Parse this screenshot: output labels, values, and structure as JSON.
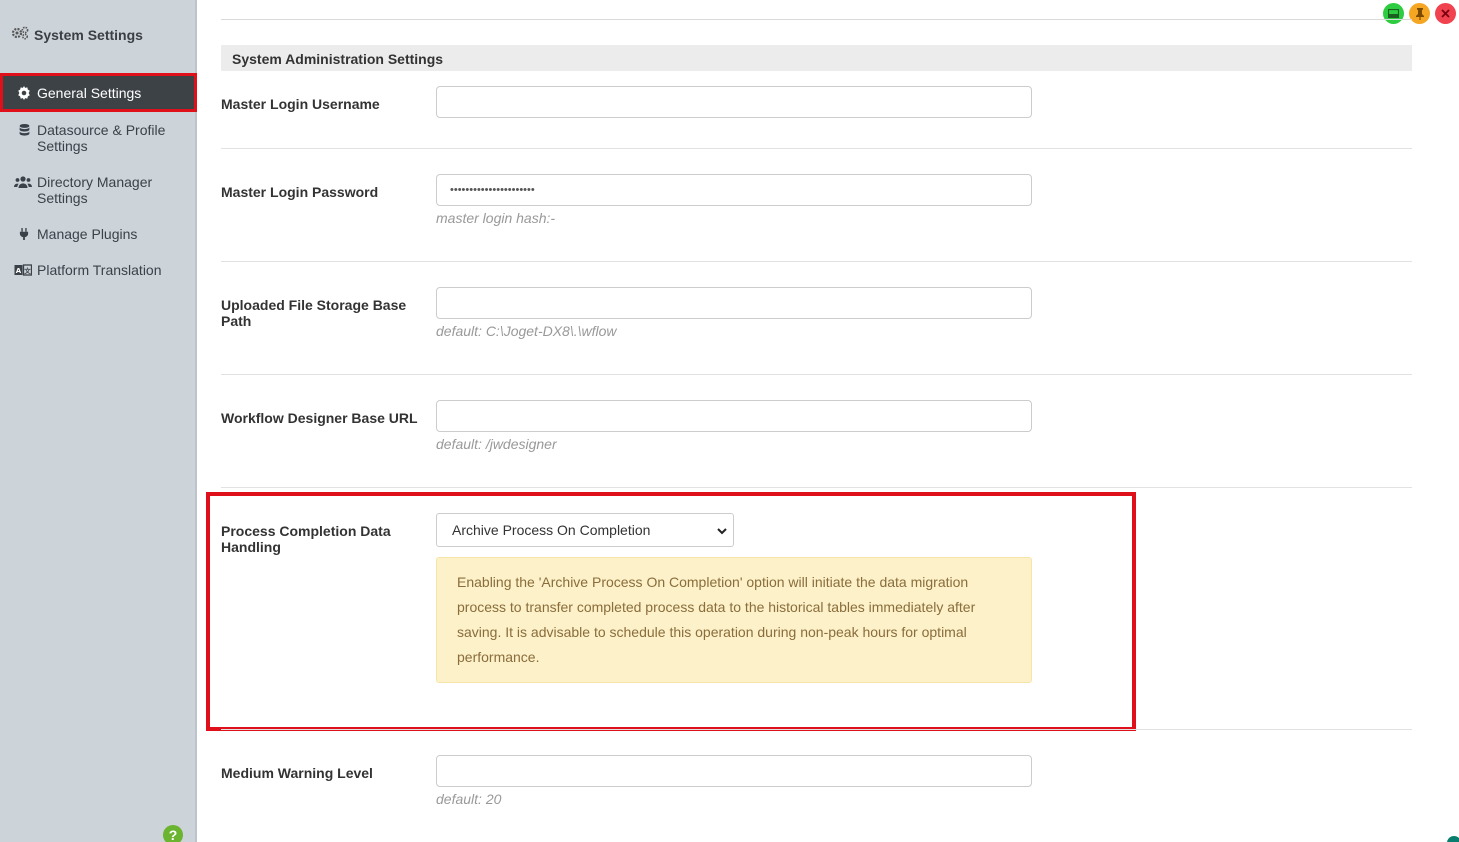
{
  "sidebar": {
    "title": "System Settings",
    "items": [
      {
        "label": "General Settings",
        "icon": "gear-icon",
        "active": true
      },
      {
        "label": "Datasource & Profile Settings",
        "icon": "database-icon",
        "active": false
      },
      {
        "label": "Directory Manager Settings",
        "icon": "users-icon",
        "active": false
      },
      {
        "label": "Manage Plugins",
        "icon": "plug-icon",
        "active": false
      },
      {
        "label": "Platform Translation",
        "icon": "translate-icon",
        "active": false
      }
    ],
    "help": "?"
  },
  "window_controls": {
    "colors": {
      "green": "#2ecc40",
      "yellow": "#f5a623",
      "red": "#f0434f"
    }
  },
  "main": {
    "section_title": "System Administration Settings",
    "fields": {
      "master_username": {
        "label": "Master Login Username",
        "value": ""
      },
      "master_password": {
        "label": "Master Login Password",
        "value": "••••••••••••••••••••••",
        "hint": "master login hash:-"
      },
      "file_storage": {
        "label": "Uploaded File Storage Base Path",
        "value": "",
        "hint": "default: C:\\Joget-DX8\\.\\wflow"
      },
      "designer_url": {
        "label": "Workflow Designer Base URL",
        "value": "",
        "hint": "default: /jwdesigner"
      },
      "process_completion": {
        "label": "Process Completion Data Handling",
        "selected": "Archive Process On Completion",
        "alert": "Enabling the 'Archive Process On Completion' option will initiate the data migration process to transfer completed process data to the historical tables immediately after saving. It is advisable to schedule this operation during non-peak hours for optimal performance."
      },
      "medium_warning": {
        "label": "Medium Warning Level",
        "value": "",
        "hint": "default: 20"
      }
    }
  },
  "colors": {
    "sidebar_bg": "#ccd3d9",
    "active_bg": "#3d4247",
    "highlight": "#e0101a",
    "alert_bg": "#fcf1c9",
    "alert_text": "#8a6d3b"
  }
}
